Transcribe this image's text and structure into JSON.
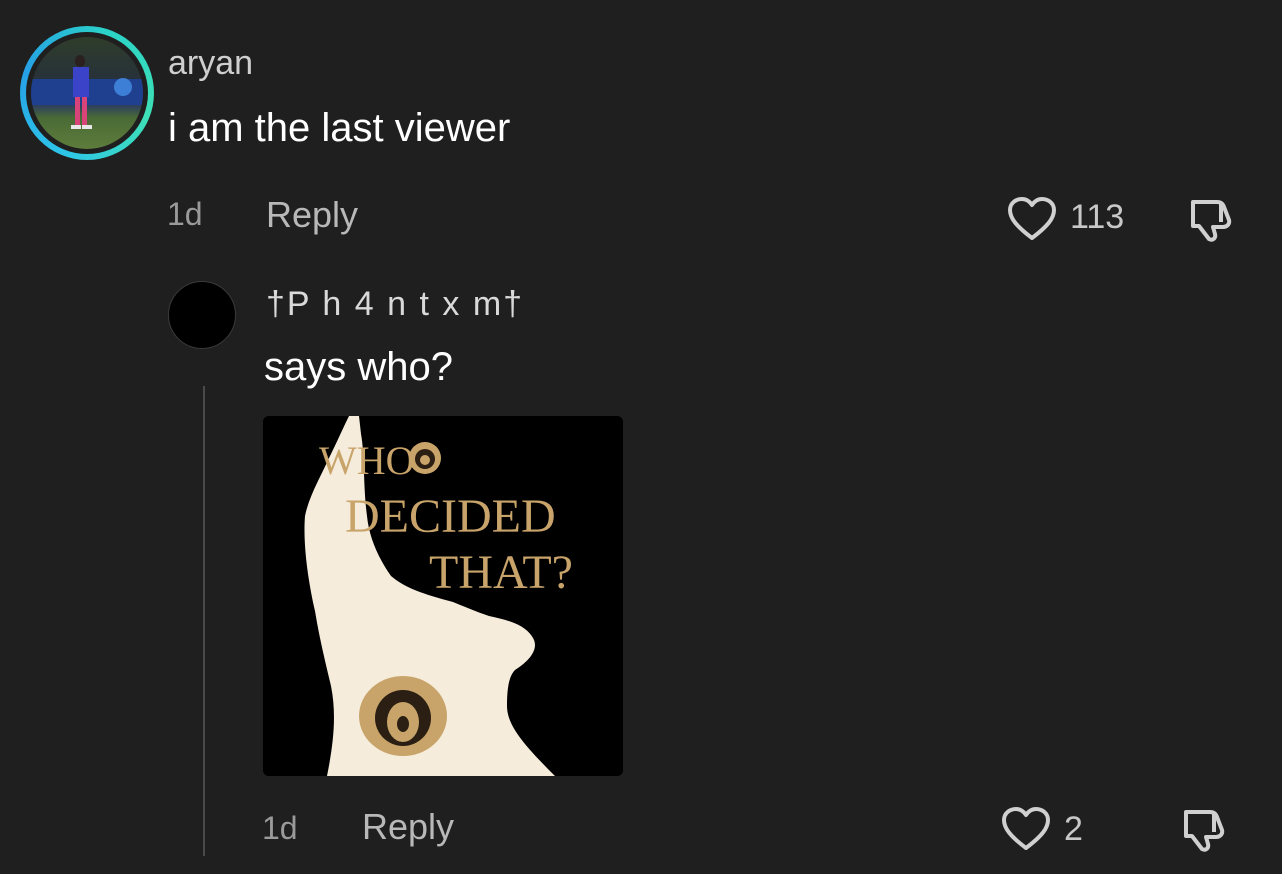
{
  "comment": {
    "username": "aryan",
    "text": "i am the last viewer",
    "age": "1d",
    "reply_label": "Reply",
    "like_count": "113",
    "avatar_ring_colors": [
      "#2ec6e8",
      "#3ee0b6"
    ]
  },
  "reply": {
    "username": "†P h 4 n t x m†",
    "text": "says who?",
    "age": "1d",
    "reply_label": "Reply",
    "like_count": "2",
    "image": {
      "line1": "WHO",
      "line2": "DECIDED",
      "line3": "THAT?"
    }
  },
  "icons": {
    "like": "heart-outline-icon",
    "dislike": "thumbs-down-icon"
  },
  "colors": {
    "background": "#1f1f1f",
    "meme_text_gold": "#c8a46a",
    "meme_silhouette": "#f5ecdc"
  }
}
